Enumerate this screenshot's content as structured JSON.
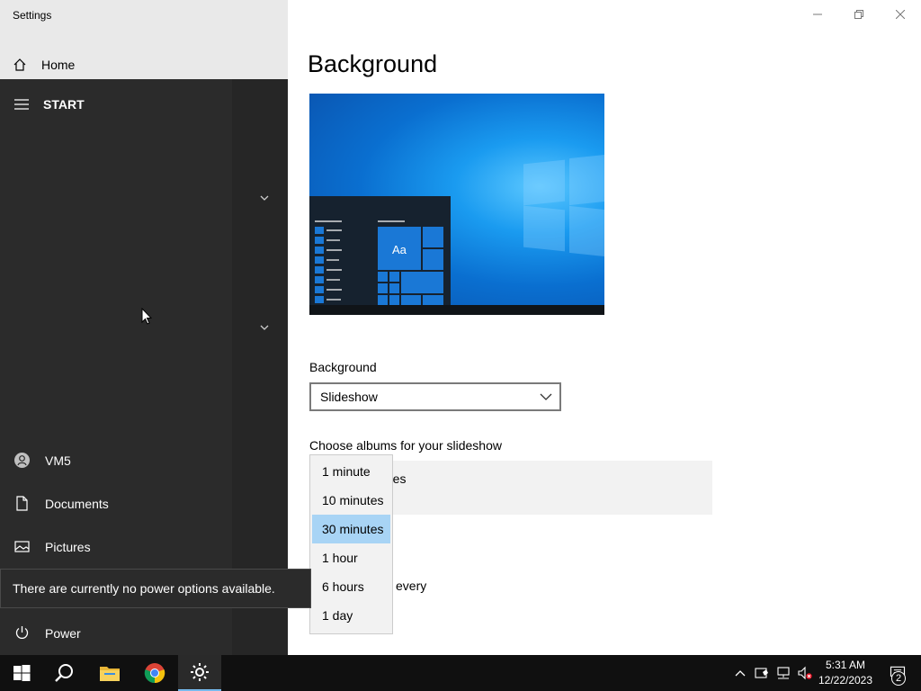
{
  "window": {
    "app_title": "Settings",
    "nav_home": "Home",
    "controls": [
      "minimize-icon",
      "restore-icon",
      "close-icon"
    ]
  },
  "page": {
    "title": "Background",
    "background_label": "Background",
    "background_value": "Slideshow",
    "albums_label": "Choose albums for your slideshow",
    "album_partial_text": "res",
    "change_every_partial": "every"
  },
  "interval_dropdown": {
    "options": [
      "1 minute",
      "10 minutes",
      "30 minutes",
      "1 hour",
      "6 hours",
      "1 day"
    ],
    "selected": "30 minutes",
    "selected_bg": "#a8d4f5"
  },
  "start_menu": {
    "header": "START",
    "items": [
      {
        "label": "VM5",
        "icon": "user-avatar-icon"
      },
      {
        "label": "Documents",
        "icon": "document-icon"
      },
      {
        "label": "Pictures",
        "icon": "pictures-icon"
      },
      {
        "label": "Power",
        "icon": "power-icon"
      }
    ],
    "tooltip": "There are currently no power options available."
  },
  "preview": {
    "tile_text": "Aa"
  },
  "taskbar": {
    "apps": [
      "windows-start-icon",
      "search-icon",
      "file-explorer-icon",
      "chrome-icon",
      "settings-gear-icon"
    ],
    "time": "5:31 AM",
    "date": "12/22/2023",
    "notification_count": "2",
    "accent": "#76b9ed"
  }
}
